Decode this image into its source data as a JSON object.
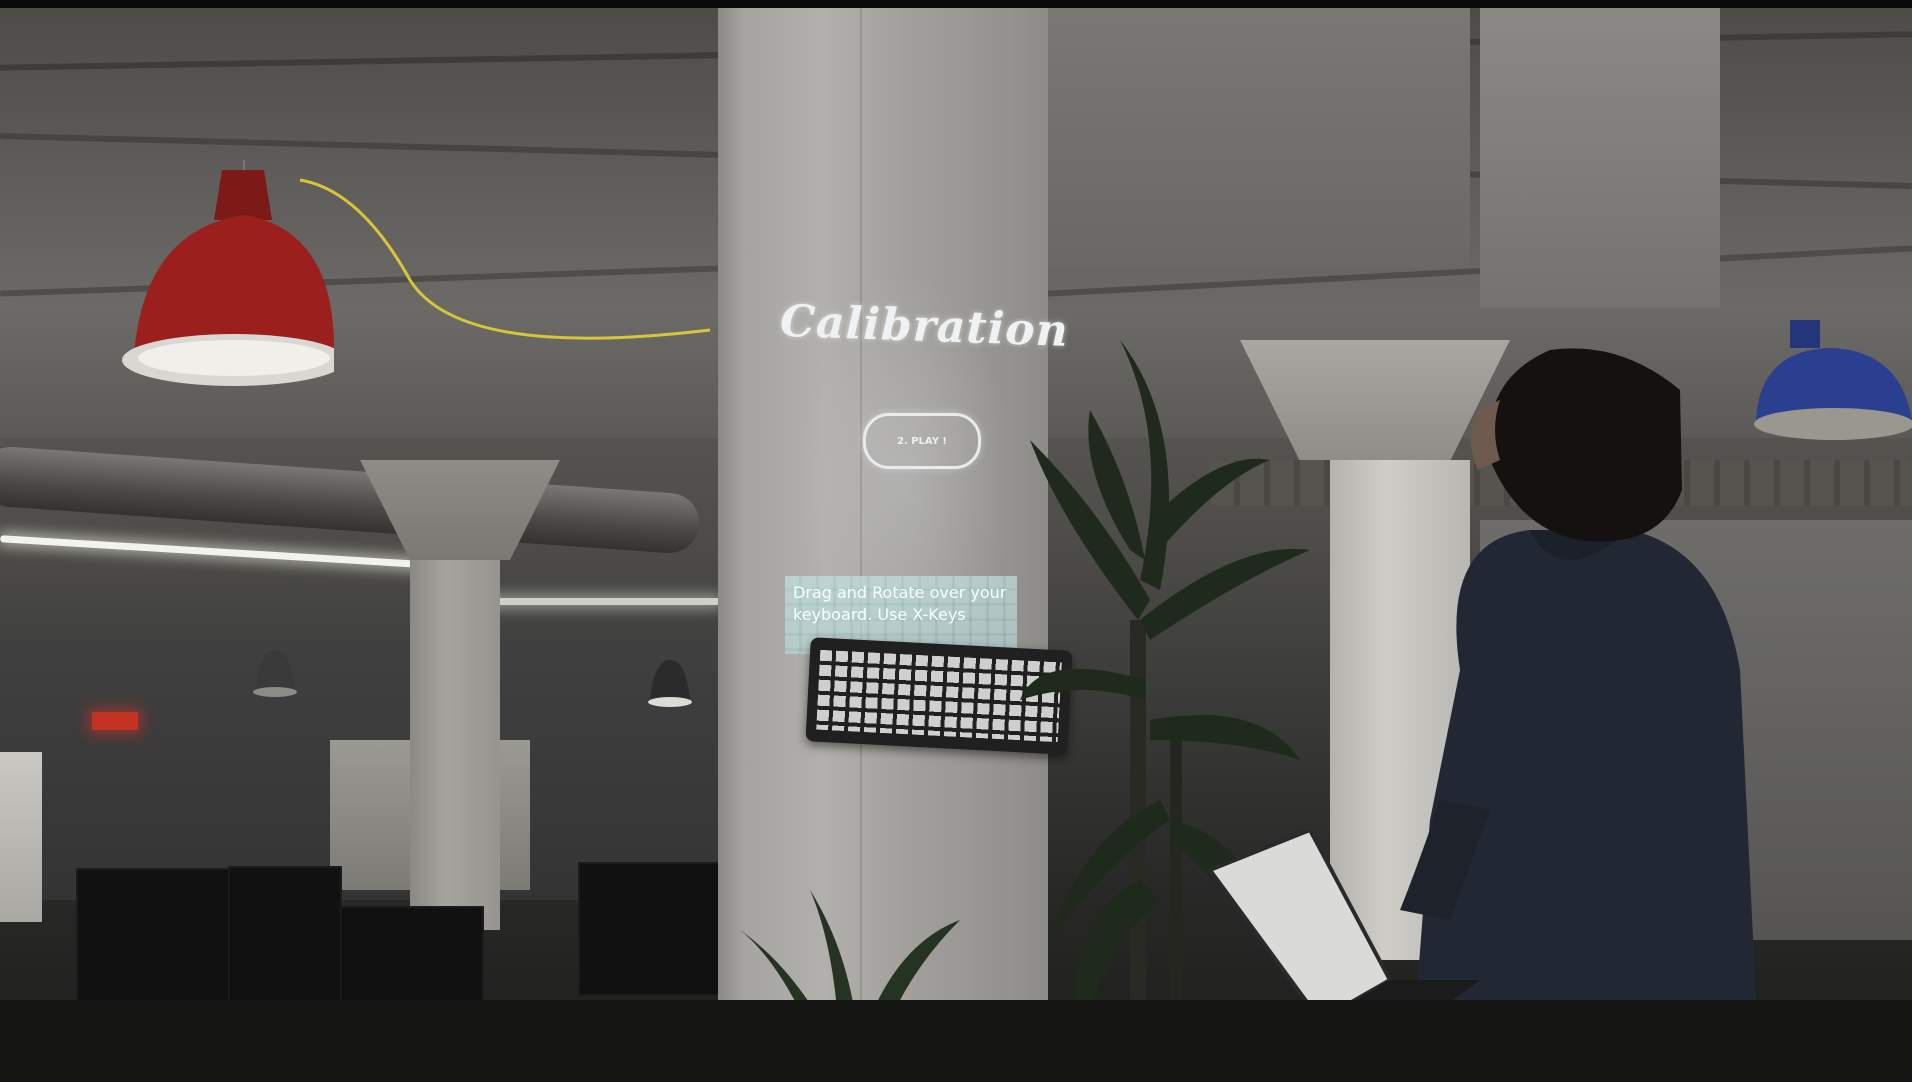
{
  "projection": {
    "title": "Calibration",
    "button_label": "2. PLAY !",
    "instruction": "Drag and Rotate over your keyboard. Use X-Keys"
  },
  "colors": {
    "projection_text": "#eef2f2",
    "instruction_overlay": "#9fd6d6",
    "lamp_red": "#9b1f1c",
    "lamp_blue": "#2a3f8f",
    "exit_sign": "#c43224"
  },
  "objects": {
    "keyboard_icon": "keyboard-icon",
    "laptop_icon": "laptop-icon",
    "lamp_icon": "pendant-lamp-icon",
    "plant_icon": "plant-icon",
    "person_icon": "person-icon"
  }
}
